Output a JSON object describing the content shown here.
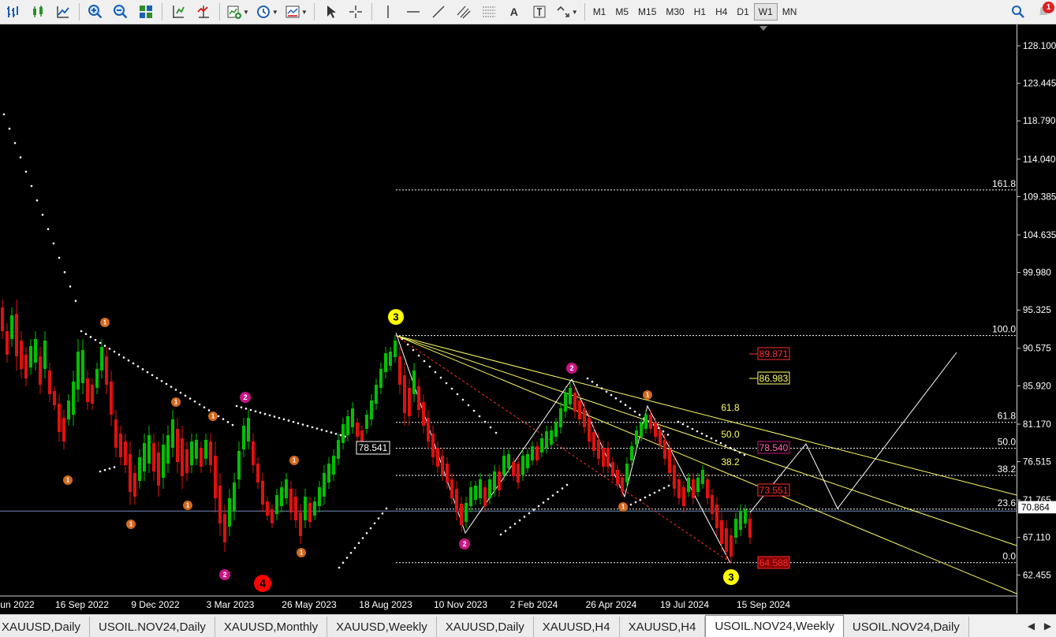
{
  "toolbar": {
    "timeframes": [
      "M1",
      "M5",
      "M15",
      "M30",
      "H1",
      "H4",
      "D1",
      "W1",
      "MN"
    ],
    "active_timeframe": "W1",
    "text_tool_label": "A",
    "notification_count": "1"
  },
  "price_axis": {
    "labels": [
      "128.100",
      "123.445",
      "118.790",
      "114.040",
      "109.385",
      "104.635",
      "99.980",
      "95.325",
      "90.575",
      "85.920",
      "81.170",
      "76.515",
      "71.765",
      "67.110",
      "62.455"
    ],
    "current_price": "70.864"
  },
  "time_axis": {
    "labels": [
      "un 2022",
      "16 Sep 2022",
      "9 Dec 2022",
      "3 Mar 2023",
      "26 May 2023",
      "18 Aug 2023",
      "10 Nov 2023",
      "2 Feb 2024",
      "26 Apr 2024",
      "19 Jul 2024",
      "15 Sep 2024"
    ]
  },
  "fibonacci": {
    "levels": [
      "161.8",
      "100.0",
      "61.8",
      "50.0",
      "38.2",
      "23.6",
      "0.0"
    ],
    "fan_labels": [
      "61.8",
      "50.0",
      "38.2"
    ],
    "price_boxes": [
      "89.871",
      "86.983",
      "78.540",
      "73.551",
      "64.588"
    ],
    "anchor_label": "78.541"
  },
  "wave_labels": {
    "major_3_top": "3",
    "major_3_bottom": "3",
    "major_4": "4",
    "minor_1": "1",
    "minor_2": "2"
  },
  "tabs": [
    "XAUUSD,Daily",
    "USOIL.NOV24,Daily",
    "XAUUSD,Monthly",
    "XAUUSD,Weekly",
    "XAUUSD,Daily",
    "XAUUSD,H4",
    "XAUUSD,H4",
    "USOIL.NOV24,Weekly",
    "USOIL.NOV24,Daily"
  ],
  "active_tab": "USOIL.NOV24,Weekly",
  "colors": {
    "bull": "#00c000",
    "bear": "#e01010",
    "fib_line": "#ffffff",
    "trend_line": "#ffff66",
    "red_line": "#ff3030",
    "wave_orange": "#d2691e",
    "wave_magenta": "#c71585",
    "wave_yellow": "#ffff00",
    "wave_red": "#ff0000"
  },
  "chart_data": {
    "type": "candlestick",
    "symbol": "USOIL.NOV24",
    "timeframe": "W1",
    "y_axis_range": [
      62.455,
      128.1
    ],
    "fib_retracement": {
      "high": 92.2,
      "low": 64.588
    },
    "current_price": 70.864
  }
}
